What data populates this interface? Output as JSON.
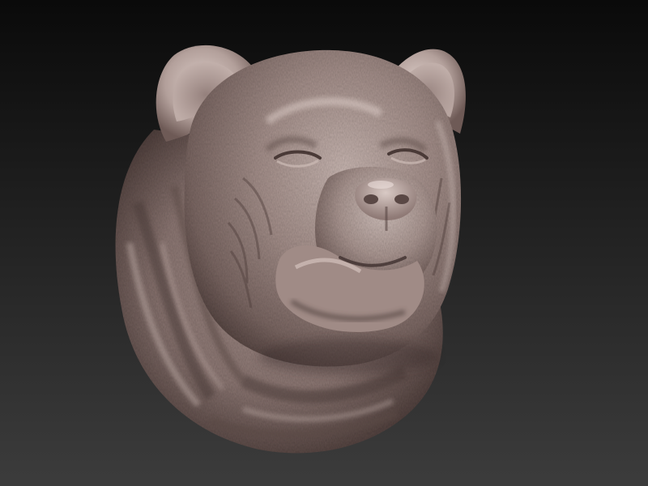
{
  "scene": {
    "subject": "bear-head-sculpt",
    "colors": {
      "background_top": "#0a0a0a",
      "background_bottom": "#3c3c3c",
      "clay_base": "#9a8580",
      "clay_highlight": "#d6c6c1",
      "clay_shadow": "#5a4845",
      "clay_deep_shadow": "#3a2c2a"
    }
  }
}
